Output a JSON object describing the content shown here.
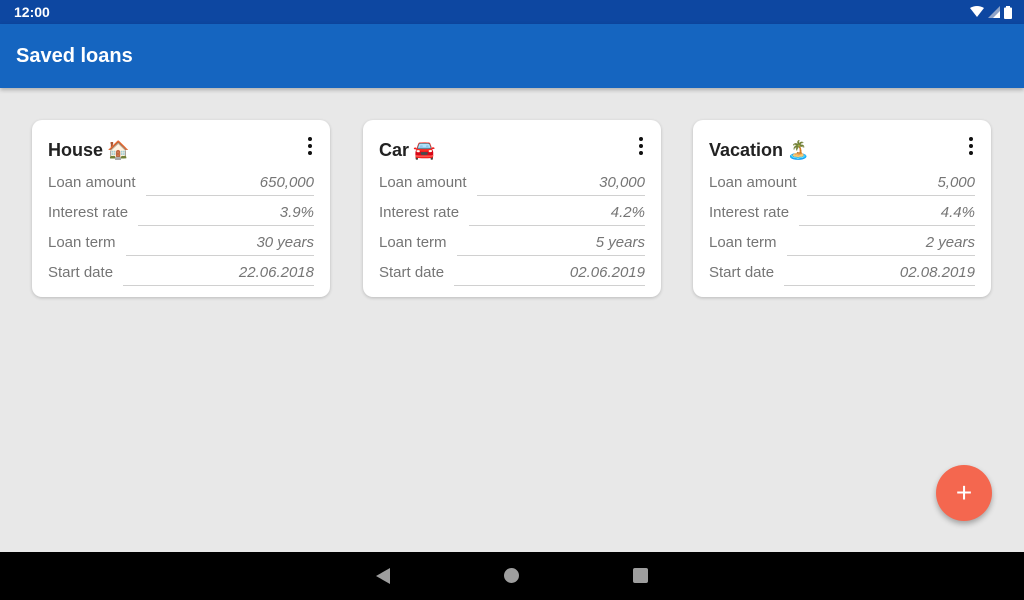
{
  "status_bar": {
    "time": "12:00",
    "icons": [
      "wifi-icon",
      "cell-signal-icon",
      "battery-icon"
    ]
  },
  "app_bar": {
    "title": "Saved loans"
  },
  "loans": [
    {
      "title": "House",
      "emoji": "🏠",
      "fields": [
        {
          "label": "Loan amount",
          "value": "650,000"
        },
        {
          "label": "Interest rate",
          "value": "3.9%"
        },
        {
          "label": "Loan term",
          "value": "30 years"
        },
        {
          "label": "Start date",
          "value": "22.06.2018"
        }
      ]
    },
    {
      "title": "Car",
      "emoji": "🚘",
      "fields": [
        {
          "label": "Loan amount",
          "value": "30,000"
        },
        {
          "label": "Interest rate",
          "value": "4.2%"
        },
        {
          "label": "Loan term",
          "value": "5 years"
        },
        {
          "label": "Start date",
          "value": "02.06.2019"
        }
      ]
    },
    {
      "title": "Vacation",
      "emoji": "🏝️",
      "fields": [
        {
          "label": "Loan amount",
          "value": "5,000"
        },
        {
          "label": "Interest rate",
          "value": "4.4%"
        },
        {
          "label": "Loan term",
          "value": "2 years"
        },
        {
          "label": "Start date",
          "value": "02.08.2019"
        }
      ]
    }
  ],
  "fab": {
    "symbol": "+",
    "icon": "add-icon"
  },
  "colors": {
    "status_bar": "#0d47a1",
    "app_bar": "#1565c0",
    "fab": "#f4674f",
    "background": "#e8e8e8"
  }
}
